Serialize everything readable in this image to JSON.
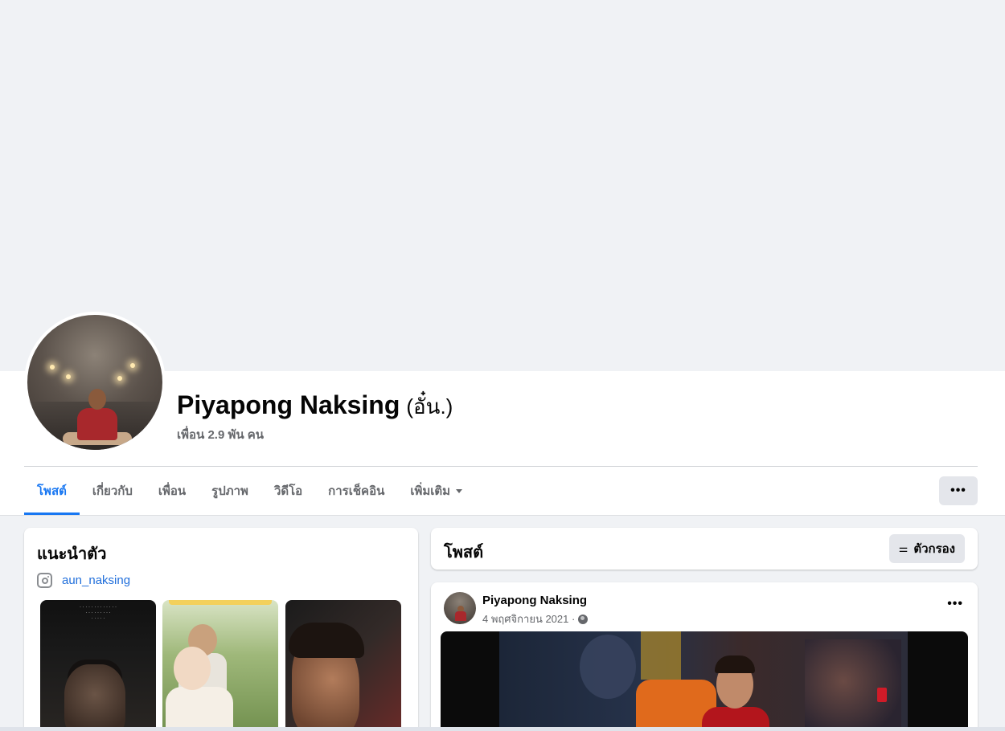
{
  "profile": {
    "name": "Piyapong Naksing",
    "nickname": "(อั๋น.)",
    "friends": "เพื่อน 2.9 พัน คน"
  },
  "tabs": [
    {
      "label": "โพสต์",
      "active": true
    },
    {
      "label": "เกี่ยวกับ"
    },
    {
      "label": "เพื่อน"
    },
    {
      "label": "รูปภาพ"
    },
    {
      "label": "วิดีโอ"
    },
    {
      "label": "การเช็คอิน"
    },
    {
      "label": "เพิ่มเติม"
    }
  ],
  "header_actions": {
    "more_label": "•••"
  },
  "intro": {
    "title": "แนะนำตัว",
    "instagram": "aun_naksing",
    "instagram_icon": "instagram-icon"
  },
  "posts_section": {
    "title": "โพสต์",
    "filter_label": "ตัวกรอง",
    "filter_icon": "filter-sliders-icon"
  },
  "post": {
    "author": "Piyapong Naksing",
    "date": "4 พฤศจิกายน 2021 ·",
    "privacy_icon": "globe-icon",
    "more_label": "•••"
  },
  "colors": {
    "accent": "#1877f2",
    "link": "#216fdb",
    "secondary_text": "#65676b",
    "background": "#f0f2f5"
  }
}
